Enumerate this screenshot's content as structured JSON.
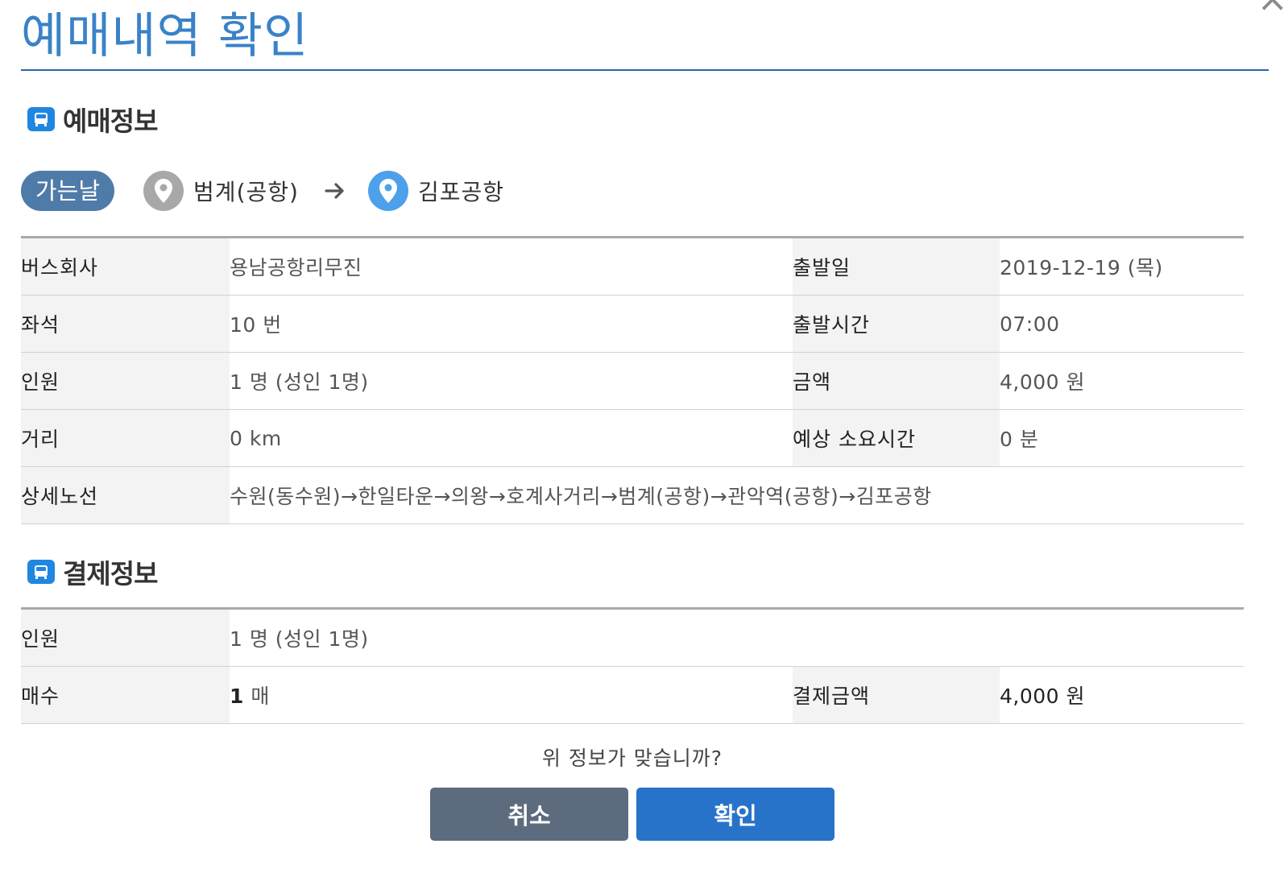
{
  "close_icon": "×",
  "title": "예매내역 확인",
  "reservation_section": {
    "heading": "예매정보",
    "route": {
      "badge": "가는날",
      "origin": "범계(공항)",
      "destination": "김포공항"
    },
    "rows": [
      {
        "label1": "버스회사",
        "value1": "용남공항리무진",
        "label2": "출발일",
        "value2": "2019-12-19 (목)"
      },
      {
        "label1": "좌석",
        "value1": "10 번",
        "label2": "출발시간",
        "value2": "07:00"
      },
      {
        "label1": "인원",
        "value1": "1 명 (성인 1명)",
        "label2": "금액",
        "value2": "4,000 원"
      },
      {
        "label1": "거리",
        "value1": "0 km",
        "label2": "예상 소요시간",
        "value2": "0 분"
      }
    ],
    "route_detail": {
      "label": "상세노선",
      "value": "수원(동수원)→한일타운→의왕→호계사거리→범계(공항)→관악역(공항)→김포공항"
    }
  },
  "payment_section": {
    "heading": "결제정보",
    "people": {
      "label": "인원",
      "value": "1 명 (성인 1명)"
    },
    "count": {
      "label": "매수",
      "number": "1",
      "unit": "매"
    },
    "amount": {
      "label": "결제금액",
      "value": "4,000 원"
    }
  },
  "question": "위 정보가 맞습니까?",
  "buttons": {
    "cancel": "취소",
    "confirm": "확인"
  },
  "colors": {
    "title": "#3a82c8",
    "title_rule": "#2a64ae",
    "badge": "#4f7ba8",
    "origin_pin": "#a8a8a8",
    "destination_pin": "#4da0ea",
    "cancel_button": "#5d6b7e",
    "confirm_button": "#2773c9",
    "section_icon": "#1f87e0"
  },
  "icons": {
    "section": "bus-icon",
    "origin": "map-pin-icon",
    "destination": "map-pin-icon",
    "route_arrow": "arrow-right-icon",
    "close": "close-icon"
  }
}
